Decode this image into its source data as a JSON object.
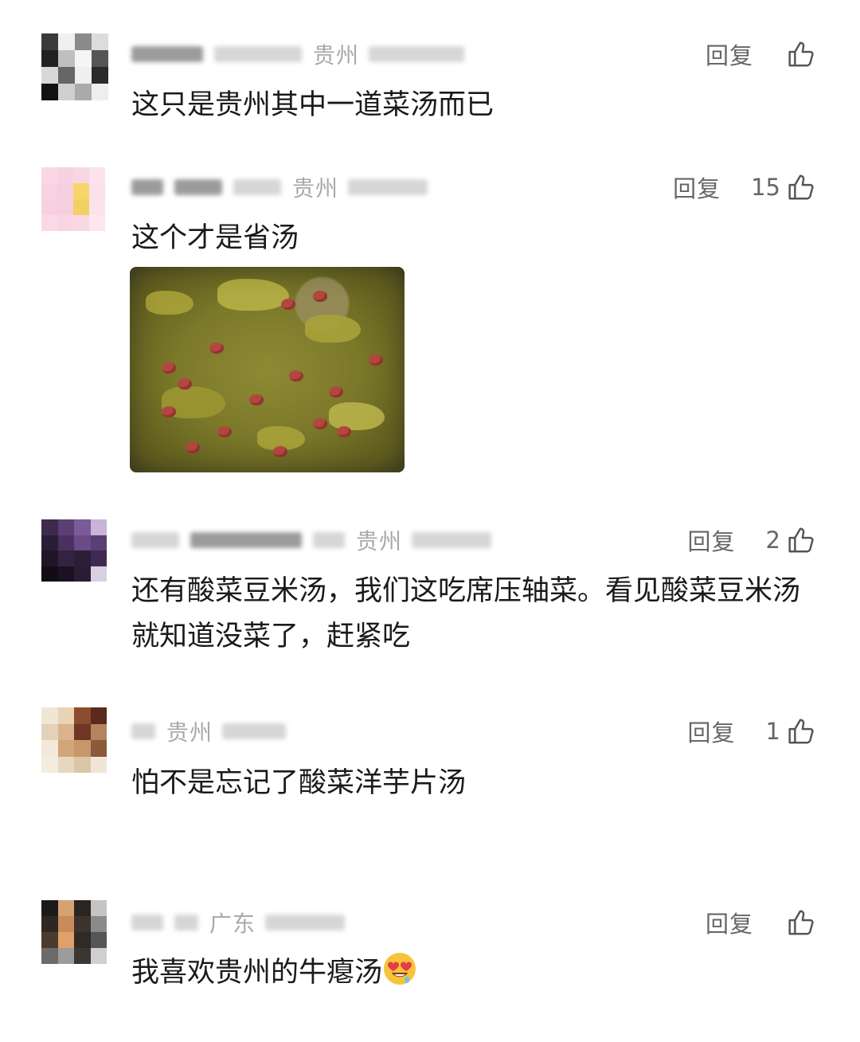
{
  "comments": [
    {
      "region": "贵州",
      "reply_label": "回复",
      "likes": "",
      "text": "这只是贵州其中一道菜汤而已",
      "avatar_colors": [
        "#3a3a3a",
        "#f0f0f0",
        "#8a8a8a",
        "#dcdcdc",
        "#222",
        "#bfbfbf",
        "#f5f5f5",
        "#555",
        "#d8d8d8",
        "#666",
        "#efefef",
        "#2a2a2a",
        "#111",
        "#cfcfcf",
        "#aaa",
        "#eee"
      ]
    },
    {
      "region": "贵州",
      "reply_label": "回复",
      "likes": "15",
      "text": "这个才是省汤",
      "avatar_colors": [
        "#f9d7e4",
        "#f7d2e0",
        "#f9d6e3",
        "#fbe2ec",
        "#f8d3e1",
        "#f7cfe0",
        "#f5d66a",
        "#fae0ea",
        "#f8d1e1",
        "#f6cfdf",
        "#f3d062",
        "#fbe3ec",
        "#fad9e6",
        "#f9d5e3",
        "#f9d8e5",
        "#fde6ef"
      ]
    },
    {
      "region": "贵州",
      "reply_label": "回复",
      "likes": "2",
      "text": "还有酸菜豆米汤，我们这吃席压轴菜。看见酸菜豆米汤就知道没菜了，赶紧吃",
      "avatar_colors": [
        "#3d2a4e",
        "#5b3f73",
        "#7b5a99",
        "#c8b5d8",
        "#2a1d36",
        "#4a3160",
        "#6b4b87",
        "#5a3f75",
        "#1e1526",
        "#33233f",
        "#2d1e38",
        "#3f2a52",
        "#120c18",
        "#1a1222",
        "#2b1c36",
        "#d9cfe2"
      ]
    },
    {
      "region": "贵州",
      "reply_label": "回复",
      "likes": "1",
      "text": "怕不是忘记了酸菜洋芋片汤",
      "avatar_colors": [
        "#efe6d4",
        "#e9d3b4",
        "#8b4c2f",
        "#5a2a1c",
        "#e4d2b8",
        "#d9b48e",
        "#6e3724",
        "#b5835e",
        "#f2e9da",
        "#d2a47a",
        "#c9966c",
        "#8a5a3b",
        "#f3ece0",
        "#e6d7c0",
        "#dcc6a6",
        "#f0e6d6"
      ]
    },
    {
      "region": "广东",
      "reply_label": "回复",
      "likes": "",
      "text": "我喜欢贵州的牛瘪汤",
      "avatar_colors": [
        "#1b1a18",
        "#d6a274",
        "#2a2520",
        "#c4c4c4",
        "#2e2723",
        "#c98b5a",
        "#3c332c",
        "#8a8a8a",
        "#4a3b2e",
        "#e0a06a",
        "#2f2a25",
        "#555",
        "#6b6b6b",
        "#9c9c9c",
        "#3a3632",
        "#cfcfcf"
      ]
    }
  ]
}
